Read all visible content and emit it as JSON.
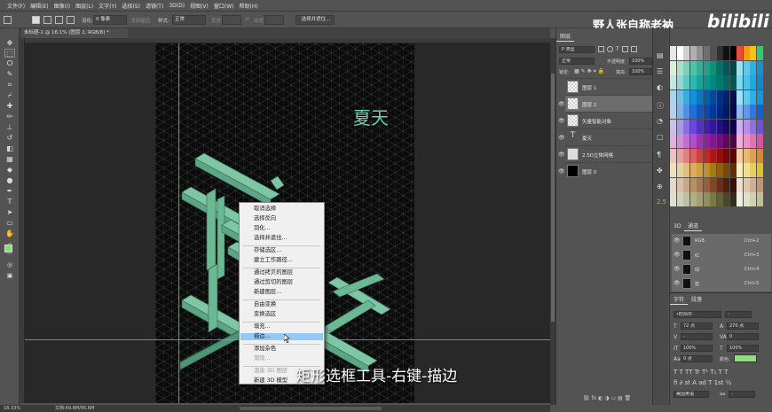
{
  "menu": [
    "文件(F)",
    "编辑(E)",
    "图像(I)",
    "图层(L)",
    "文字(Y)",
    "选择(S)",
    "滤镜(T)",
    "3D(D)",
    "视图(V)",
    "窗口(W)",
    "帮助(H)"
  ],
  "options_bar": {
    "feather_label": "羽化:",
    "feather_value": "0 像素",
    "antialias": "消除锯齿",
    "style_label": "样式:",
    "style_value": "正常",
    "width_label": "宽度:",
    "height_label": "高度:",
    "select_mask_button": "选择并遮住..."
  },
  "document_tab": "未标题-1 @ 18.1% (图层 2, RGB/8) *",
  "status": {
    "zoom": "18.33%",
    "doc_info": "文档:49.8M/95.6M"
  },
  "canvas_text": "夏天",
  "context_menu": {
    "items": [
      {
        "label": "取消选择",
        "disabled": false,
        "highlighted": false,
        "sep_before": false
      },
      {
        "label": "选择反向",
        "disabled": false,
        "highlighted": false,
        "sep_before": false
      },
      {
        "label": "羽化...",
        "disabled": false,
        "highlighted": false,
        "sep_before": false
      },
      {
        "label": "选择并遮住...",
        "disabled": false,
        "highlighted": false,
        "sep_before": false
      },
      {
        "label": "存储选区...",
        "disabled": false,
        "highlighted": false,
        "sep_before": true
      },
      {
        "label": "建立工作路径...",
        "disabled": false,
        "highlighted": false,
        "sep_before": false
      },
      {
        "label": "通过拷贝的图层",
        "disabled": false,
        "highlighted": false,
        "sep_before": true
      },
      {
        "label": "通过剪切的图层",
        "disabled": false,
        "highlighted": false,
        "sep_before": false
      },
      {
        "label": "新建图层...",
        "disabled": false,
        "highlighted": false,
        "sep_before": false
      },
      {
        "label": "自由变换",
        "disabled": false,
        "highlighted": false,
        "sep_before": true
      },
      {
        "label": "变换选区",
        "disabled": false,
        "highlighted": false,
        "sep_before": false
      },
      {
        "label": "填充...",
        "disabled": false,
        "highlighted": false,
        "sep_before": true
      },
      {
        "label": "描边...",
        "disabled": false,
        "highlighted": true,
        "sep_before": false
      },
      {
        "label": "添加杂色",
        "disabled": false,
        "highlighted": false,
        "sep_before": true
      },
      {
        "label": "渐隐...",
        "disabled": true,
        "highlighted": false,
        "sep_before": false
      },
      {
        "label": "渲染 3D 图层",
        "disabled": true,
        "highlighted": false,
        "sep_before": true
      },
      {
        "label": "新建 3D 模型",
        "disabled": false,
        "highlighted": false,
        "sep_before": false
      }
    ]
  },
  "subtitle": "矩形选框工具-右键-描边",
  "watermark": {
    "author": "野人张自称老衲",
    "brand": "bilibili"
  },
  "layers_panel": {
    "tab": "图层",
    "filter_kind": "P 类型",
    "blend_mode": "正常",
    "opacity_label": "不透明度:",
    "opacity_value": "100%",
    "lock_label": "锁定:",
    "fill_label": "填充:",
    "fill_value": "100%",
    "layers": [
      {
        "name": "图层 1",
        "visible": false,
        "selected": false,
        "thumb": "checker"
      },
      {
        "name": "图层 2",
        "visible": true,
        "selected": true,
        "thumb": "checker"
      },
      {
        "name": "矢量智能对象",
        "visible": true,
        "selected": false,
        "thumb": "checker"
      },
      {
        "name": "夏天",
        "visible": true,
        "selected": false,
        "thumb": "text"
      },
      {
        "name": "2.5D立体网格",
        "visible": true,
        "selected": false,
        "thumb": "grid"
      },
      {
        "name": "图层 0",
        "visible": true,
        "selected": false,
        "thumb": "black"
      }
    ]
  },
  "right_icon_label": "2.5",
  "channels_panel": {
    "tabs": [
      "3D",
      "通道"
    ],
    "channels": [
      {
        "name": "RGB",
        "key": "Ctrl+2"
      },
      {
        "name": "红",
        "key": "Ctrl+3"
      },
      {
        "name": "绿",
        "key": "Ctrl+4"
      },
      {
        "name": "蓝",
        "key": "Ctrl+5"
      }
    ]
  },
  "character_panel": {
    "tabs": [
      "字符",
      "段落"
    ],
    "font": "•时尚中",
    "size": "72 点",
    "leading": "270 点",
    "tracking": "0",
    "scale_v": "100%",
    "scale_h": "100%",
    "baseline": "0 点",
    "color_label": "颜色:",
    "language": "美国英语",
    "aa": "aa",
    "colors": {
      "accent": "#8ee07a"
    }
  },
  "colors": {
    "text_green": "#6fcfae",
    "letter_face": "#7fc6a4",
    "guide": "#3fc8d8",
    "menu_highlight": "#91c9f7",
    "foreground_swatch": "#7fe27b"
  }
}
